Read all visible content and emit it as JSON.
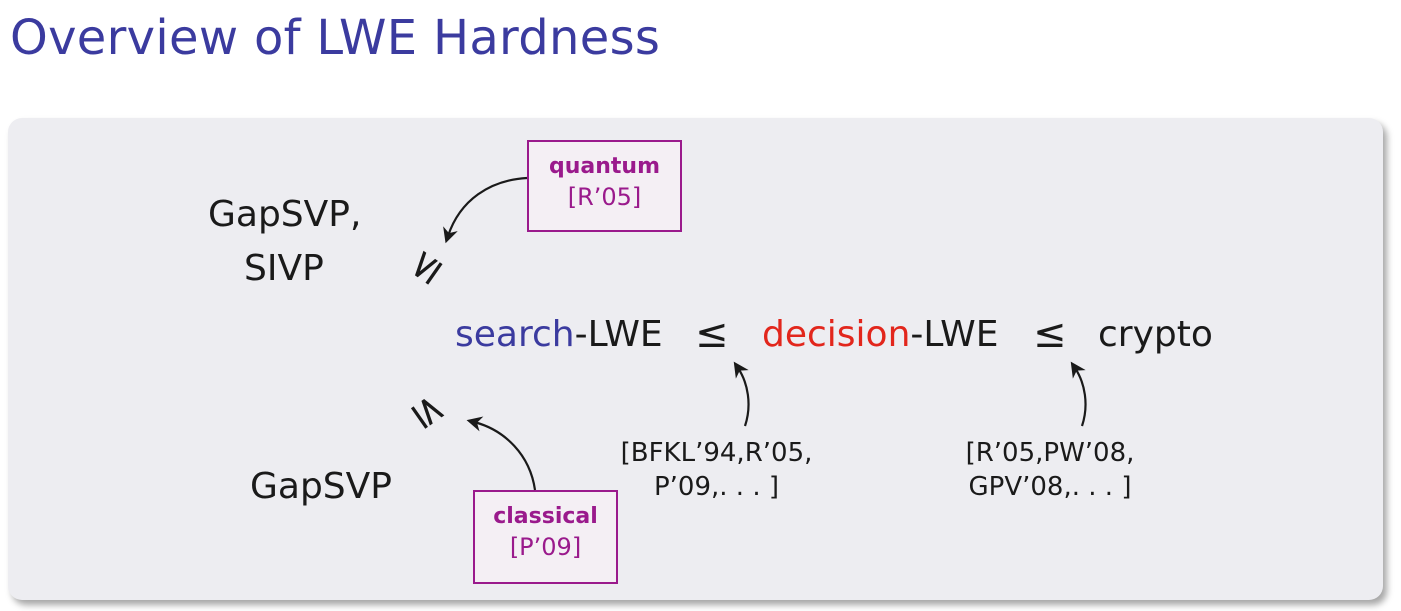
{
  "slide": {
    "title": "Overview of LWE Hardness"
  },
  "diagram": {
    "left_top": {
      "line1": "GapSVP,",
      "line2": "SIVP"
    },
    "left_bottom": "GapSVP",
    "chain": {
      "search_word": "search",
      "search_suffix": "-LWE",
      "decision_word": "decision",
      "decision_suffix": "-LWE",
      "crypto": "crypto",
      "leq": "≤"
    },
    "quantum_box": {
      "label": "quantum",
      "cite": "[R’05]"
    },
    "classical_box": {
      "label": "classical",
      "cite": "[P’09]"
    },
    "cite_mid": {
      "line1": "[BFKL’94,R’05,",
      "line2": "P’09,. . . ]"
    },
    "cite_right": {
      "line1": "[R’05,PW’08,",
      "line2": "GPV’08,. . . ]"
    },
    "colors": {
      "title": "#3b3b9f",
      "search": "#3b3b9f",
      "decision": "#e2261c",
      "box": "#9a1a8c"
    }
  }
}
